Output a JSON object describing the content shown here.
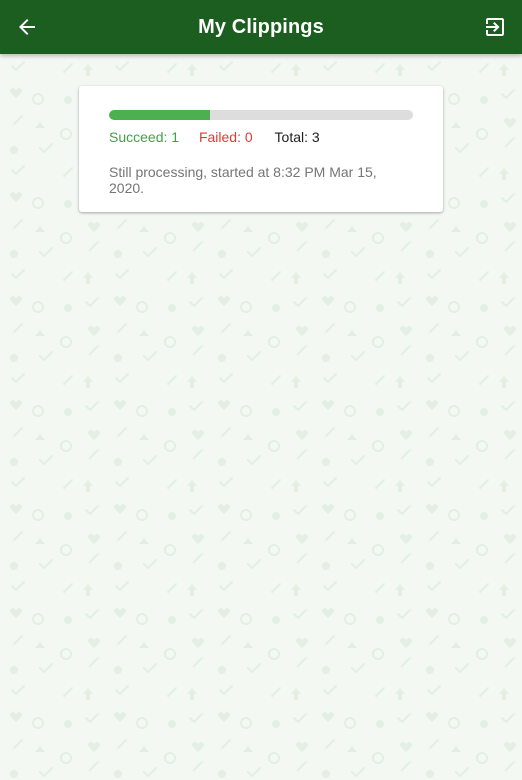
{
  "app_bar": {
    "title": "My Clippings",
    "left_icon": "arrow-back-icon",
    "right_icon": "exit-to-app-icon"
  },
  "job": {
    "progress_fraction": 0.333,
    "succeed_label": "Succeed: 1",
    "failed_label": "Failed: 0",
    "total_label": "Total: 3",
    "status_message": "Still processing, started at 8:32 PM Mar 15, 2020."
  },
  "colors": {
    "primary": "#1b5e20",
    "success": "#4caf50",
    "error": "#e53935"
  }
}
